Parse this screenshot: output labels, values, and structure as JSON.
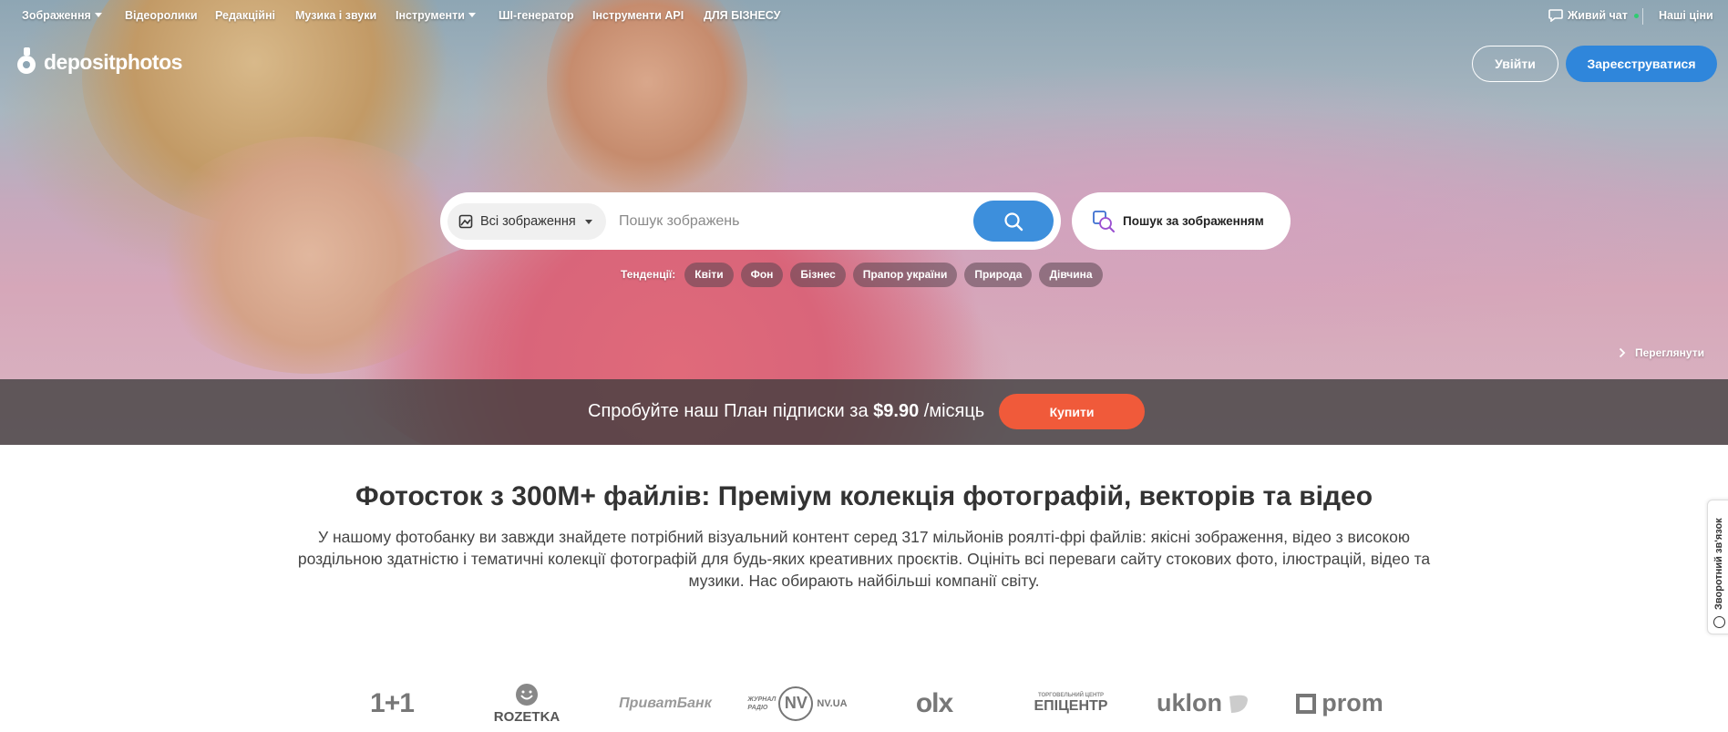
{
  "topnav": {
    "items": [
      {
        "label": "Зображення",
        "has_caret": true
      },
      {
        "label": "Відеоролики"
      },
      {
        "label": "Редакційні"
      },
      {
        "label": "Музика і звуки"
      },
      {
        "label": "Інструменти",
        "has_caret": true
      },
      {
        "label": "ШІ-генератор"
      },
      {
        "label": "Інструменти API"
      },
      {
        "label": "ДЛЯ БІЗНЕСУ"
      }
    ],
    "live_chat": "Живий чат",
    "pricing": "Наші ціни"
  },
  "logo": {
    "text": "depositphotos"
  },
  "auth": {
    "login": "Увійти",
    "register": "Зареєструватися"
  },
  "search": {
    "type_selected": "Всі зображення",
    "placeholder": "Пошук зображень",
    "image_search": "Пошук за зображенням"
  },
  "trends": {
    "label": "Тенденції:",
    "chips": [
      "Квіти",
      "Фон",
      "Бізнес",
      "Прапор україни",
      "Природа",
      "Дівчина"
    ]
  },
  "view_link": "Переглянути",
  "promo": {
    "text_before": "Спробуйте наш План підписки за ",
    "price": "$9.90",
    "text_after": " /місяць",
    "buy": "Купити"
  },
  "main": {
    "title": "Фотосток з 300M+ файлів: Преміум колекція фотографій, векторів та відео",
    "description": "У нашому фотобанку ви завжди знайдете потрібний візуальний контент серед 317 мільйонів роялті-фрі файлів: якісні зображення, відео з високою роздільною здатністю і тематичні колекції фотографій для будь-яких креативних проєктів. Оцініть всі переваги сайту стокових фото, ілюстрацій, відео та музики. Нас обирають найбільші компанії світу."
  },
  "feedback": "Зворотний зв'язок",
  "clients": [
    {
      "name": "1+1"
    },
    {
      "name": "ROZETKA"
    },
    {
      "name": "ПриватБанк"
    },
    {
      "name": "NV.UA",
      "sub": "ЖУРНАЛ РАДІО"
    },
    {
      "name": "olx"
    },
    {
      "name": "ЕПІЦЕНТР",
      "sub": "ТОРГОВЕЛЬНИЙ ЦЕНТР"
    },
    {
      "name": "uklon"
    },
    {
      "name": "prom"
    }
  ],
  "colors": {
    "accent_blue": "#2f86db",
    "buy_orange": "#f05a3a",
    "live_dot": "#2ecc71"
  }
}
